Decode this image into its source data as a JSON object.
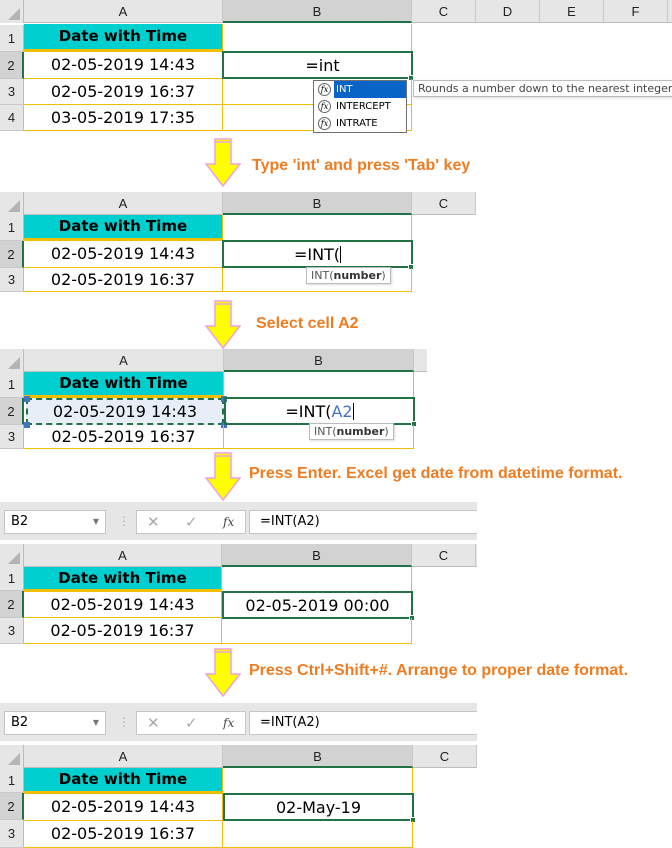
{
  "colors": {
    "title_fill": "#00cfcf",
    "cell_border": "#f0be00",
    "active_border": "#217346",
    "step_text": "#f07c22",
    "arrow_fill": "#ffff00",
    "arrow_outline": "#f0a0e0",
    "autocomplete_highlight": "#0a64c8",
    "reference_text": "#4472c4"
  },
  "panels": [
    {
      "columns": [
        "A",
        "B",
        "C",
        "D",
        "E",
        "F"
      ],
      "rows": [
        "1",
        "2",
        "3",
        "4"
      ],
      "header_cell": "Date with Time",
      "a_values": [
        "02-05-2019 14:43",
        "02-05-2019 16:37",
        "03-05-2019 17:35"
      ],
      "b2_text": "=int",
      "autocomplete": {
        "icon": "function-fx-icon",
        "items": [
          "INT",
          "INTERCEPT",
          "INTRATE"
        ],
        "selected": "INT",
        "tooltip": "Rounds a number down to the nearest integer"
      }
    },
    {
      "columns": [
        "A",
        "B",
        "C"
      ],
      "rows": [
        "1",
        "2",
        "3"
      ],
      "header_cell": "Date with Time",
      "a_values": [
        "02-05-2019 14:43",
        "02-05-2019 16:37"
      ],
      "b2_text": "=INT(",
      "arg_tip": {
        "fn": "INT(",
        "arg": "number",
        "close": ")"
      }
    },
    {
      "columns": [
        "A",
        "B"
      ],
      "rows": [
        "1",
        "2",
        "3"
      ],
      "header_cell": "Date with Time",
      "a_values": [
        "02-05-2019 14:43",
        "02-05-2019 16:37"
      ],
      "b2_prefix": "=INT(",
      "b2_ref": "A2",
      "arg_tip": {
        "fn": "INT(",
        "arg": "number",
        "close": ")"
      }
    },
    {
      "formula_bar": {
        "name_box": "B2",
        "cancel_icon": "✕",
        "enter_icon": "✓",
        "fx_label": "fx",
        "formula": "=INT(A2)"
      },
      "columns": [
        "A",
        "B",
        "C"
      ],
      "rows": [
        "1",
        "2",
        "3"
      ],
      "header_cell": "Date with Time",
      "a_values": [
        "02-05-2019 14:43",
        "02-05-2019 16:37"
      ],
      "b2_value": "02-05-2019 00:00"
    },
    {
      "formula_bar": {
        "name_box": "B2",
        "cancel_icon": "✕",
        "enter_icon": "✓",
        "fx_label": "fx",
        "formula": "=INT(A2)"
      },
      "columns": [
        "A",
        "B",
        "C"
      ],
      "rows": [
        "1",
        "2",
        "3"
      ],
      "header_cell": "Date with Time",
      "a_values": [
        "02-05-2019 14:43",
        "02-05-2019 16:37"
      ],
      "b2_value": "02-May-19"
    }
  ],
  "steps": [
    "Type 'int' and press 'Tab' key",
    "Select cell A2",
    "Press Enter. Excel get date from datetime format.",
    "Press Ctrl+Shift+#. Arrange to proper date format."
  ]
}
